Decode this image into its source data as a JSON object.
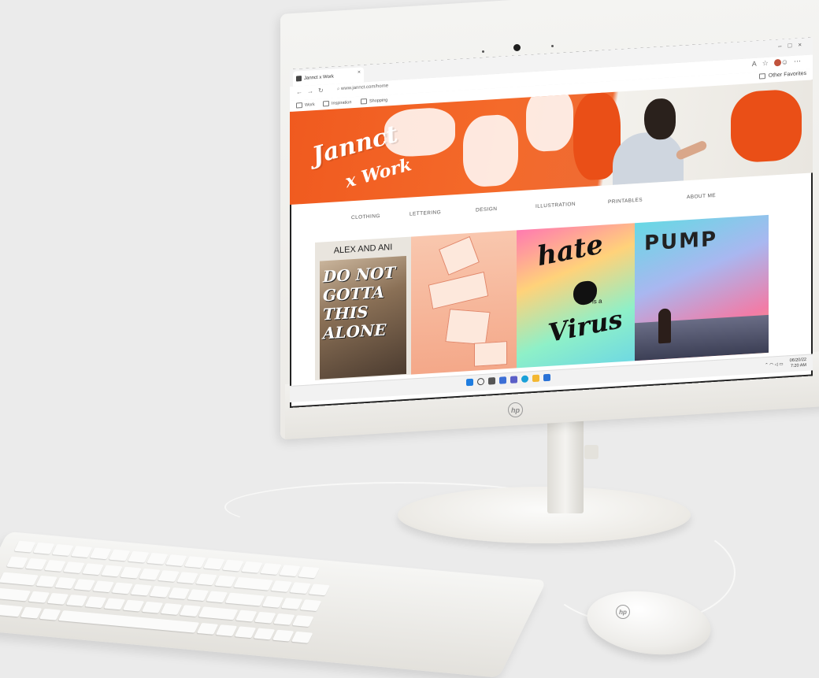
{
  "browser": {
    "tab_title": "Jannct x Work",
    "url": "www.jannct.com/home",
    "favorites": [
      "Work",
      "Inspiration",
      "Shopping"
    ],
    "other_favorites": "Other Favorites"
  },
  "site": {
    "logo_line1": "Jannct",
    "logo_line2": "x Work",
    "nav": [
      "CLOTHING",
      "LETTERING",
      "DESIGN",
      "ILLUSTRATION",
      "PRINTABLES",
      "ABOUT ME"
    ],
    "tiles": {
      "tile1_heading": "ALEX AND ANI",
      "tile1_graffiti": "DO NOT GOTTA THIS ALONE",
      "tile3_word1": "hate",
      "tile3_word2": "is a",
      "tile3_word3": "Virus",
      "tile4_word": "PUMP"
    }
  },
  "taskbar": {
    "date": "06/20/22",
    "time": "7:20 AM"
  },
  "hardware": {
    "brand_logo": "hp"
  },
  "colors": {
    "hero_orange": "#f05a1f",
    "device_white": "#f2f1ee"
  }
}
